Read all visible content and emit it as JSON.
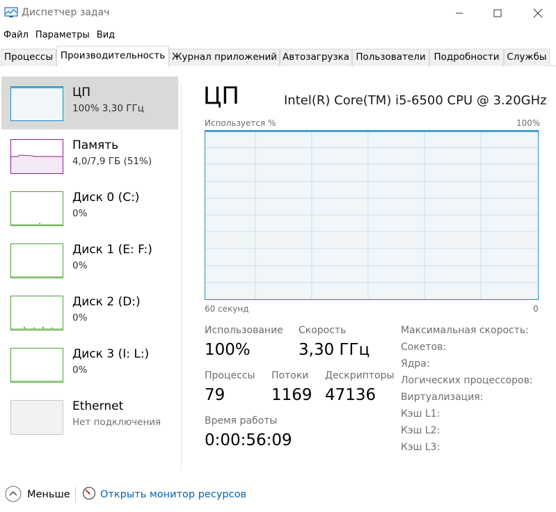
{
  "window": {
    "title": "Диспетчер задач"
  },
  "menu": [
    "Файл",
    "Параметры",
    "Вид"
  ],
  "tabs": [
    {
      "label": "Процессы",
      "active": false
    },
    {
      "label": "Производительность",
      "active": true
    },
    {
      "label": "Журнал приложений",
      "active": false
    },
    {
      "label": "Автозагрузка",
      "active": false
    },
    {
      "label": "Пользователи",
      "active": false
    },
    {
      "label": "Подробности",
      "active": false
    },
    {
      "label": "Службы",
      "active": false
    }
  ],
  "sidebar": {
    "items": [
      {
        "name": "ЦП",
        "sub": "100%  3,30 ГГц",
        "selected": true,
        "color": "#1a8fc7"
      },
      {
        "name": "Память",
        "sub": "4,0/7,9 ГБ (51%)",
        "selected": false,
        "color": "#8b1a8b"
      },
      {
        "name": "Диск 0 (C:)",
        "sub": "0%",
        "selected": false,
        "color": "#4da633"
      },
      {
        "name": "Диск 1 (E: F:)",
        "sub": "0%",
        "selected": false,
        "color": "#4da633"
      },
      {
        "name": "Диск 2 (D:)",
        "sub": "0%",
        "selected": false,
        "color": "#4da633"
      },
      {
        "name": "Диск 3 (I: L:)",
        "sub": "0%",
        "selected": false,
        "color": "#4da633"
      },
      {
        "name": "Ethernet",
        "sub": "Нет подключения",
        "selected": false,
        "color": "#a0a0a0"
      }
    ]
  },
  "main": {
    "title": "ЦП",
    "model": "Intel(R) Core(TM) i5-6500 CPU @ 3.20GHz",
    "graph_top_left": "Используется %",
    "graph_top_right": "100%",
    "graph_bottom_left": "60 секунд",
    "graph_bottom_right": "0",
    "usage_percent": 100,
    "stats": {
      "usage_label": "Использование",
      "usage_value": "100%",
      "speed_label": "Скорость",
      "speed_value": "3,30 ГГц",
      "processes_label": "Процессы",
      "processes_value": "79",
      "threads_label": "Потоки",
      "threads_value": "1169",
      "handles_label": "Дескрипторы",
      "handles_value": "47136",
      "uptime_label": "Время работы",
      "uptime_value": "0:00:56:09"
    },
    "specs": [
      "Максимальная скорость:",
      "Сокетов:",
      "Ядра:",
      "Логических процессоров:",
      "Виртуализация:",
      "Кэш L1:",
      "Кэш L2:",
      "Кэш L3:"
    ]
  },
  "footer": {
    "fewer_label": "Меньше",
    "monitor_link": "Открыть монитор ресурсов"
  },
  "colors": {
    "cpu_accent": "#1a8fc7",
    "link": "#0063b1"
  }
}
